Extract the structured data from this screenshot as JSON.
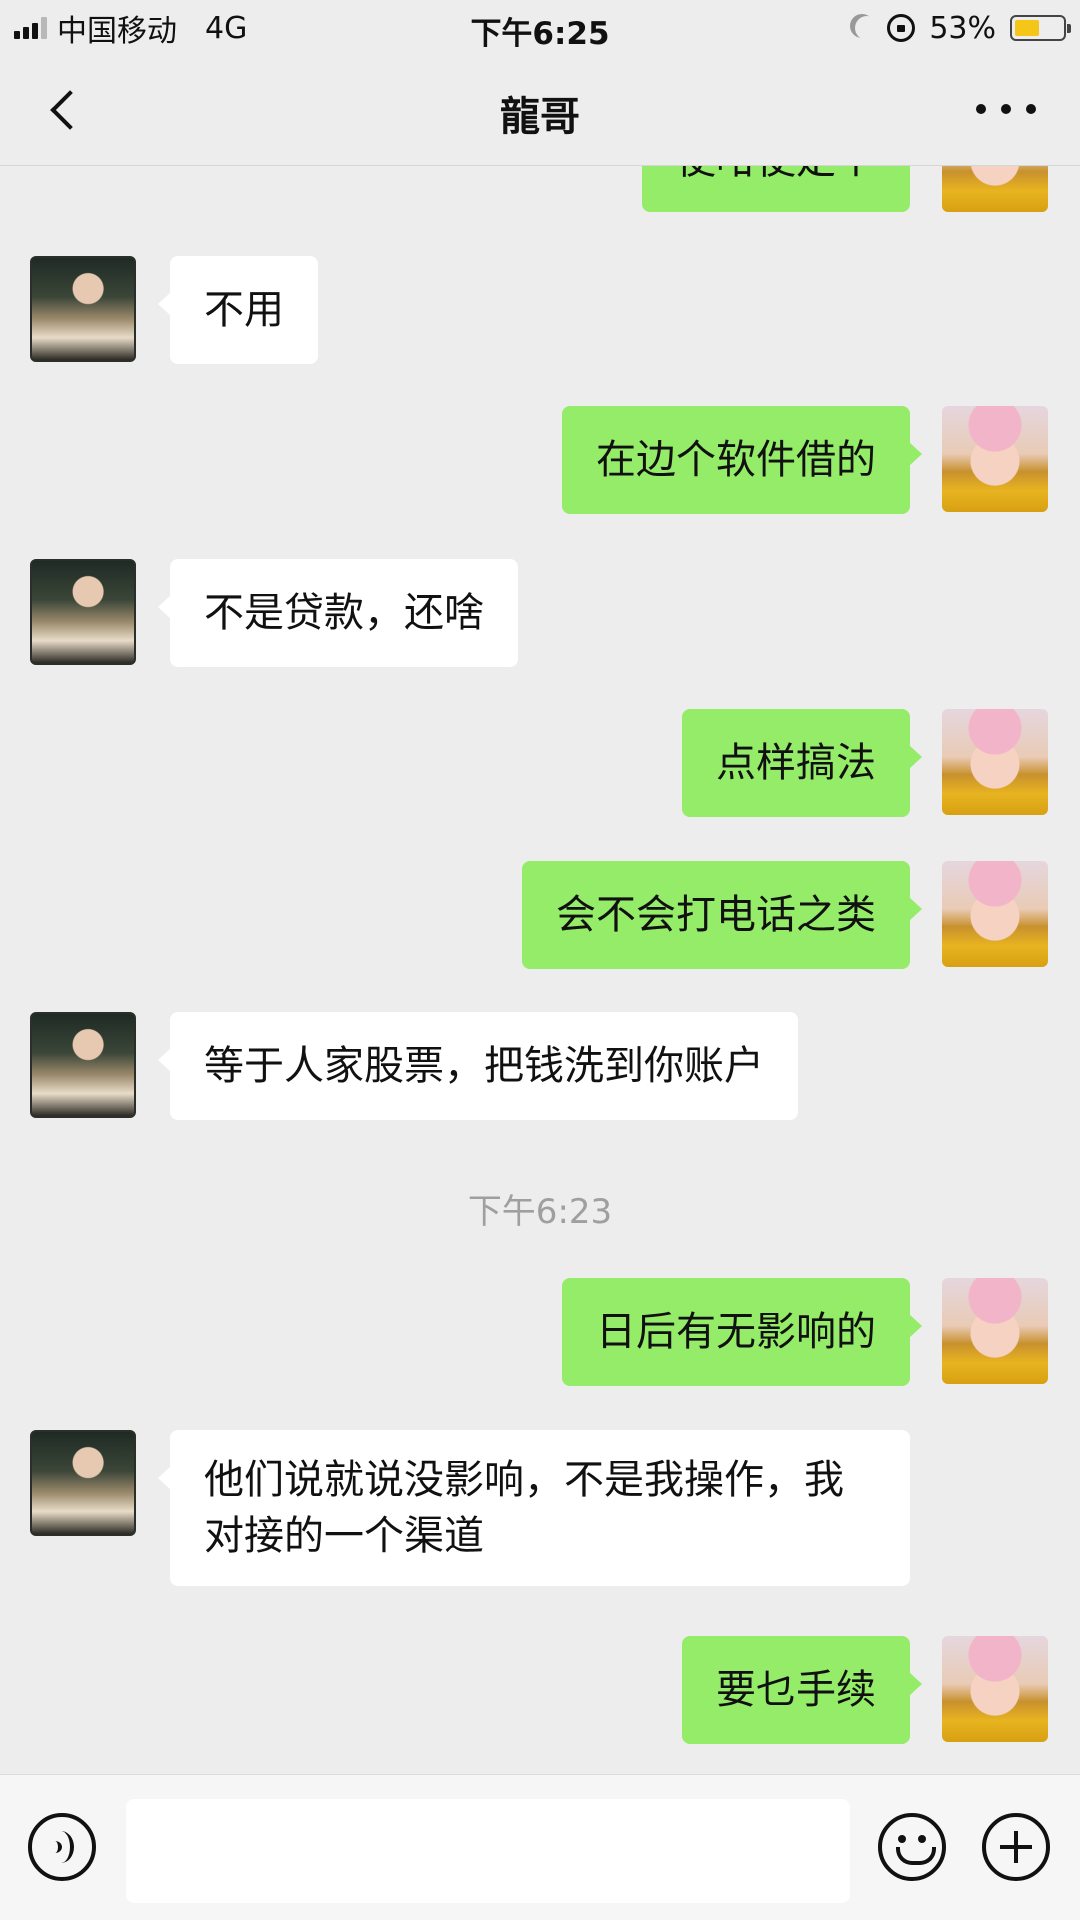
{
  "status_bar": {
    "carrier": "中国移动",
    "network": "4G",
    "time": "下午6:25",
    "battery_percent": "53%",
    "battery_level": 0.53,
    "battery_color": "#f5c518"
  },
  "nav": {
    "title": "龍哥",
    "back_icon": "chevron-left-icon",
    "more_icon": "more-dots-icon"
  },
  "messages": [
    {
      "side": "out",
      "text": "使咁使定个"
    },
    {
      "side": "in",
      "text": "不用"
    },
    {
      "side": "out",
      "text": "在边个软件借的"
    },
    {
      "side": "in",
      "text": "不是贷款，还啥"
    },
    {
      "side": "out",
      "text": "点样搞法"
    },
    {
      "side": "out",
      "text": "会不会打电话之类"
    },
    {
      "side": "in",
      "text": "等于人家股票，把钱洗到你账户"
    },
    {
      "side": "time",
      "text": "下午6:23"
    },
    {
      "side": "out",
      "text": "日后有无影响的"
    },
    {
      "side": "in",
      "text": "他们说就说没影响，不是我操作，我对接的一个渠道"
    },
    {
      "side": "out",
      "text": "要乜手续"
    }
  ],
  "input_bar": {
    "voice_icon": "voice-icon",
    "text_value": "",
    "emoji_icon": "emoji-icon",
    "plus_icon": "plus-icon"
  },
  "colors": {
    "outgoing_bubble": "#95ec69",
    "incoming_bubble": "#ffffff",
    "background": "#ededed"
  }
}
